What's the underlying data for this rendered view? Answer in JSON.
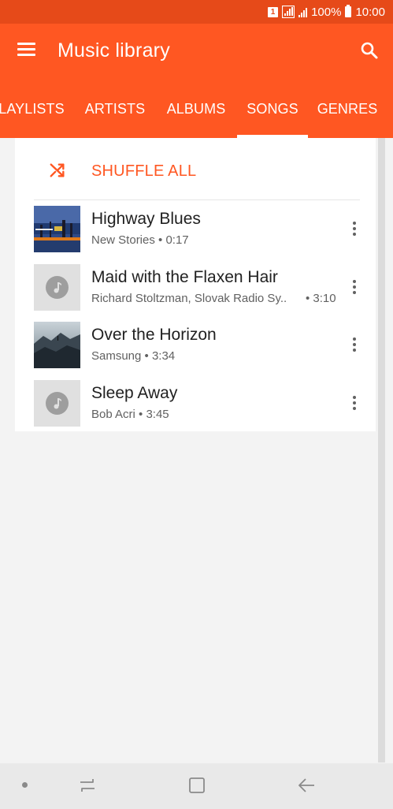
{
  "status_bar": {
    "sim_label": "1",
    "battery": "100%",
    "time": "10:00"
  },
  "app_bar": {
    "title": "Music library"
  },
  "tabs": [
    {
      "label": "LAYLISTS",
      "selected": false
    },
    {
      "label": "ARTISTS",
      "selected": false
    },
    {
      "label": "ALBUMS",
      "selected": false
    },
    {
      "label": "SONGS",
      "selected": true
    },
    {
      "label": "GENRES",
      "selected": false
    }
  ],
  "shuffle": {
    "label": "SHUFFLE ALL",
    "icon": "shuffle-icon"
  },
  "songs": [
    {
      "title": "Highway Blues",
      "subtitle": "New Stories • 0:17",
      "duration": "",
      "thumb": "album-art"
    },
    {
      "title": "Maid with the Flaxen Hair",
      "subtitle": "Richard Stoltzman, Slovak Radio Sy..",
      "duration": "• 3:10",
      "thumb": "music-note-icon"
    },
    {
      "title": "Over the Horizon",
      "subtitle": "Samsung • 3:34",
      "duration": "",
      "thumb": "album-art"
    },
    {
      "title": "Sleep Away",
      "subtitle": "Bob Acri • 3:45",
      "duration": "",
      "thumb": "music-note-icon"
    }
  ],
  "colors": {
    "status_bar": "#e64a19",
    "app_bar": "#ff5722",
    "accent": "#ff5722",
    "background": "#f3f3f3"
  },
  "nav_bar": {
    "icons": [
      "nav-dot-icon",
      "recents-icon",
      "home-icon",
      "back-icon"
    ]
  }
}
